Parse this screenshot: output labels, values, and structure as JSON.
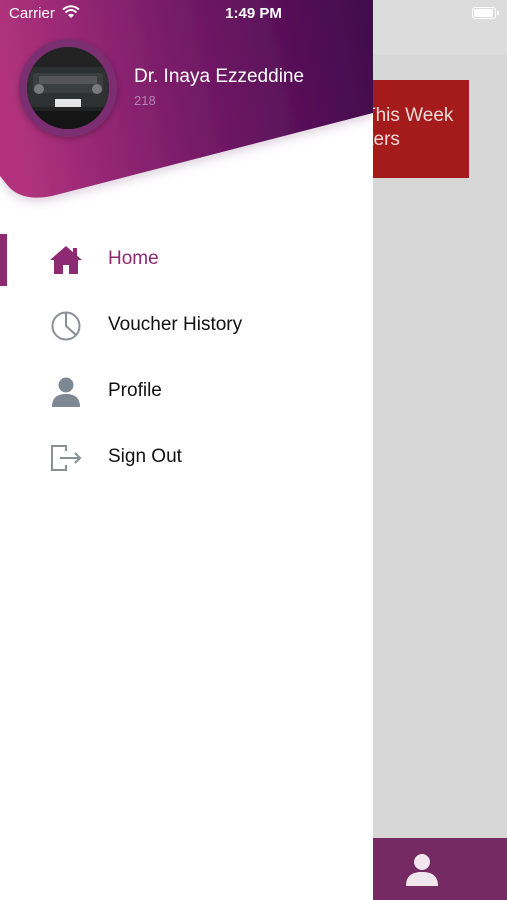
{
  "status_bar": {
    "carrier": "Carrier",
    "time": "1:49 PM"
  },
  "user": {
    "name": "Dr. Inaya Ezzeddine",
    "id": "218"
  },
  "menu": [
    {
      "label": "Home",
      "icon": "home-icon",
      "active": true
    },
    {
      "label": "Voucher History",
      "icon": "pie-chart-icon",
      "active": false
    },
    {
      "label": "Profile",
      "icon": "user-icon",
      "active": false
    },
    {
      "label": "Sign Out",
      "icon": "sign-out-icon",
      "active": false
    }
  ],
  "background": {
    "card_text": "This Week\niters"
  },
  "colors": {
    "primary": "#8d2a73",
    "header_dark": "#4a0a4f",
    "header_light": "#b3337e",
    "card_red": "#a51b1b",
    "tabbar": "#762a63"
  }
}
